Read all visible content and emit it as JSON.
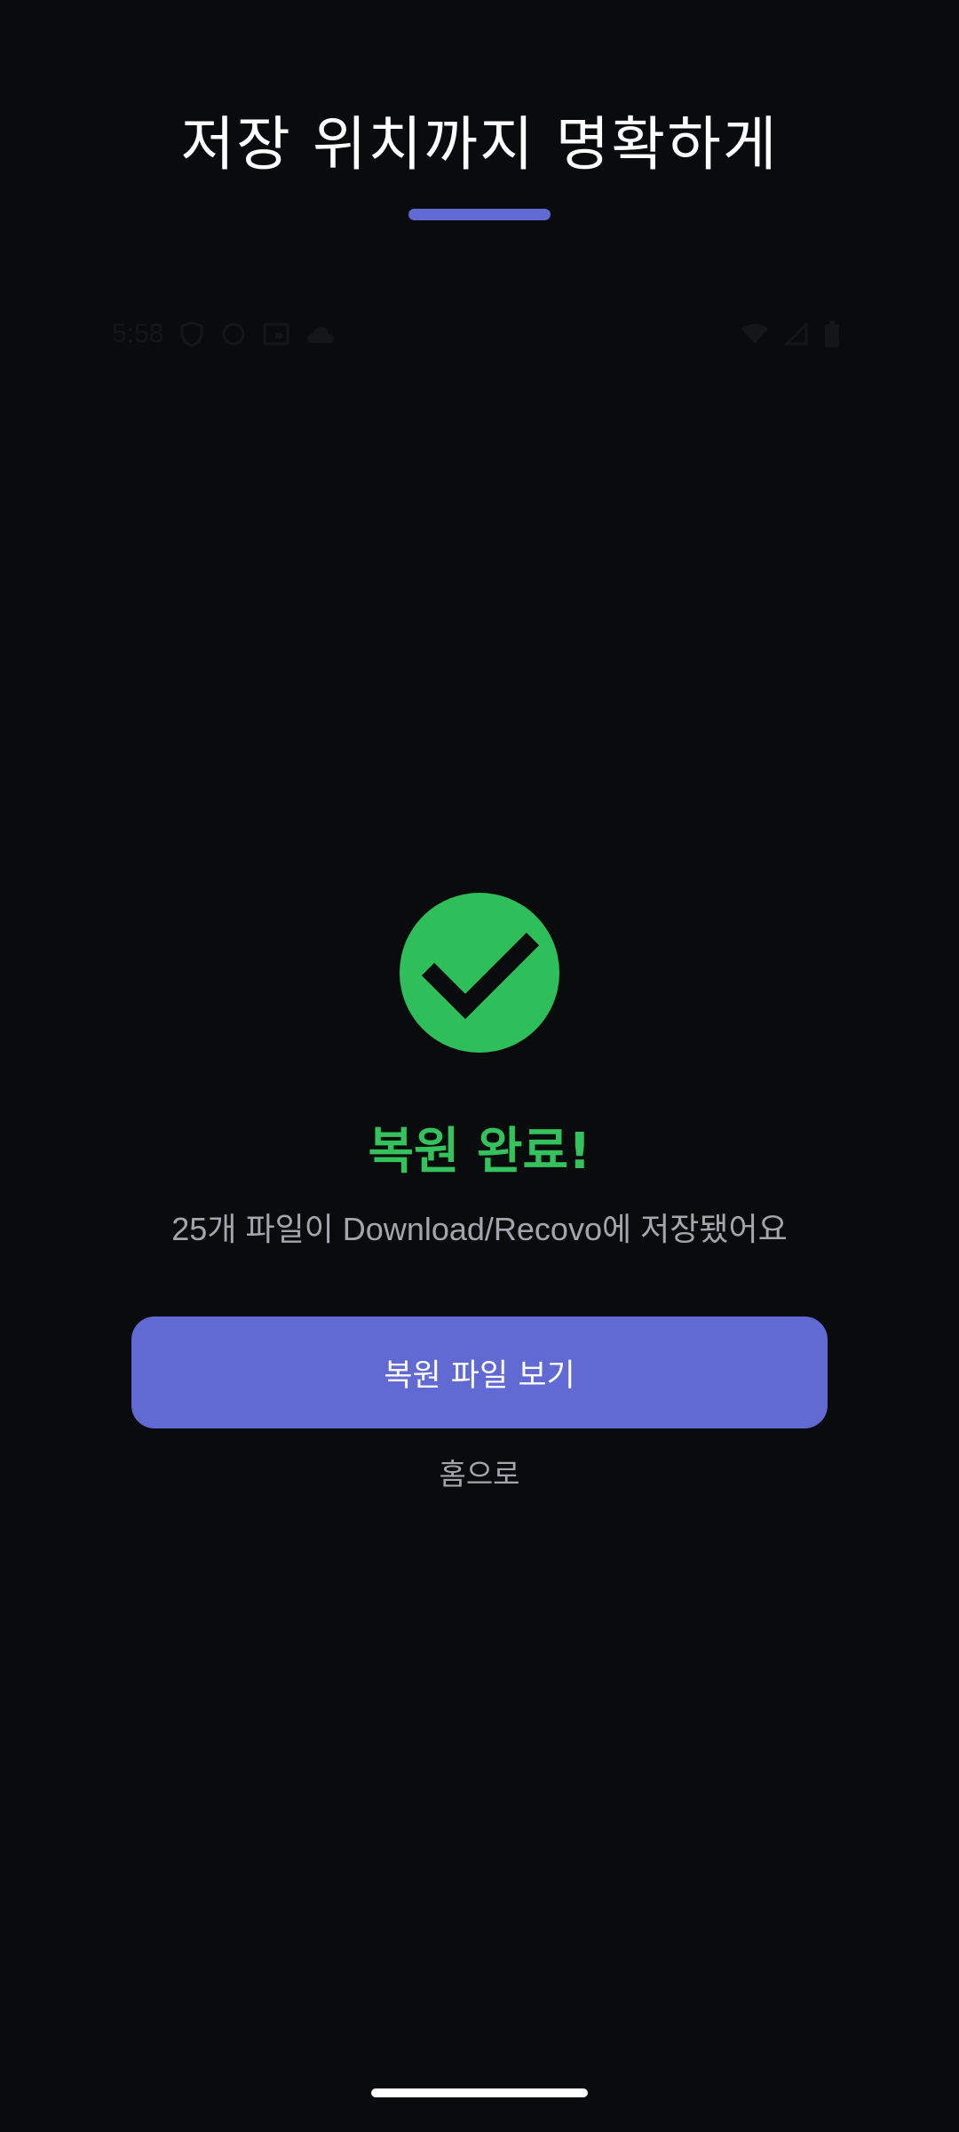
{
  "headline": {
    "text": "저장 위치까지 명확하게"
  },
  "status_bar": {
    "time": "5:58",
    "left_icons": [
      "shield-icon",
      "sync-icon",
      "calendar-icon",
      "cloud-icon"
    ],
    "right_icons": [
      "wifi-icon",
      "signal-icon",
      "battery-icon"
    ]
  },
  "result": {
    "icon": "check-icon",
    "title": "복원 완료!",
    "subtitle": "25개 파일이 Download/Recovo에 저장됐어요"
  },
  "actions": {
    "view_files_label": "복원 파일 보기",
    "home_label": "홈으로"
  },
  "colors": {
    "background": "#0a0b0d",
    "accent": "#6169d3",
    "success": "#2fbf5a",
    "muted_text": "#a3a6ad"
  }
}
